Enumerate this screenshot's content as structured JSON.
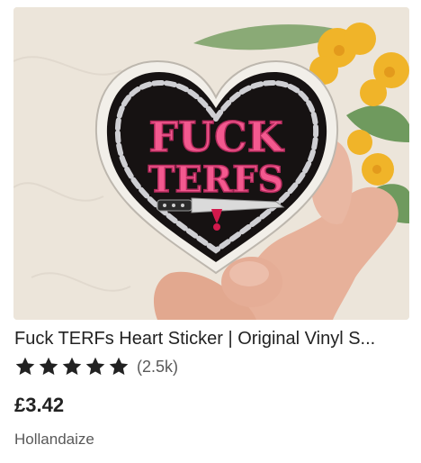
{
  "listing": {
    "title": "Fuck TERFs Heart Sticker | Original Vinyl S...",
    "image_alt_icon": "product-photo",
    "sticker_line1": "FUCK",
    "sticker_line2": "TERFS",
    "rating": {
      "stars": 5,
      "max_stars": 5,
      "count_text": "(2.5k)",
      "star_color": "#222222"
    },
    "price": "£3.42",
    "shop_name": "Hollandaize"
  }
}
